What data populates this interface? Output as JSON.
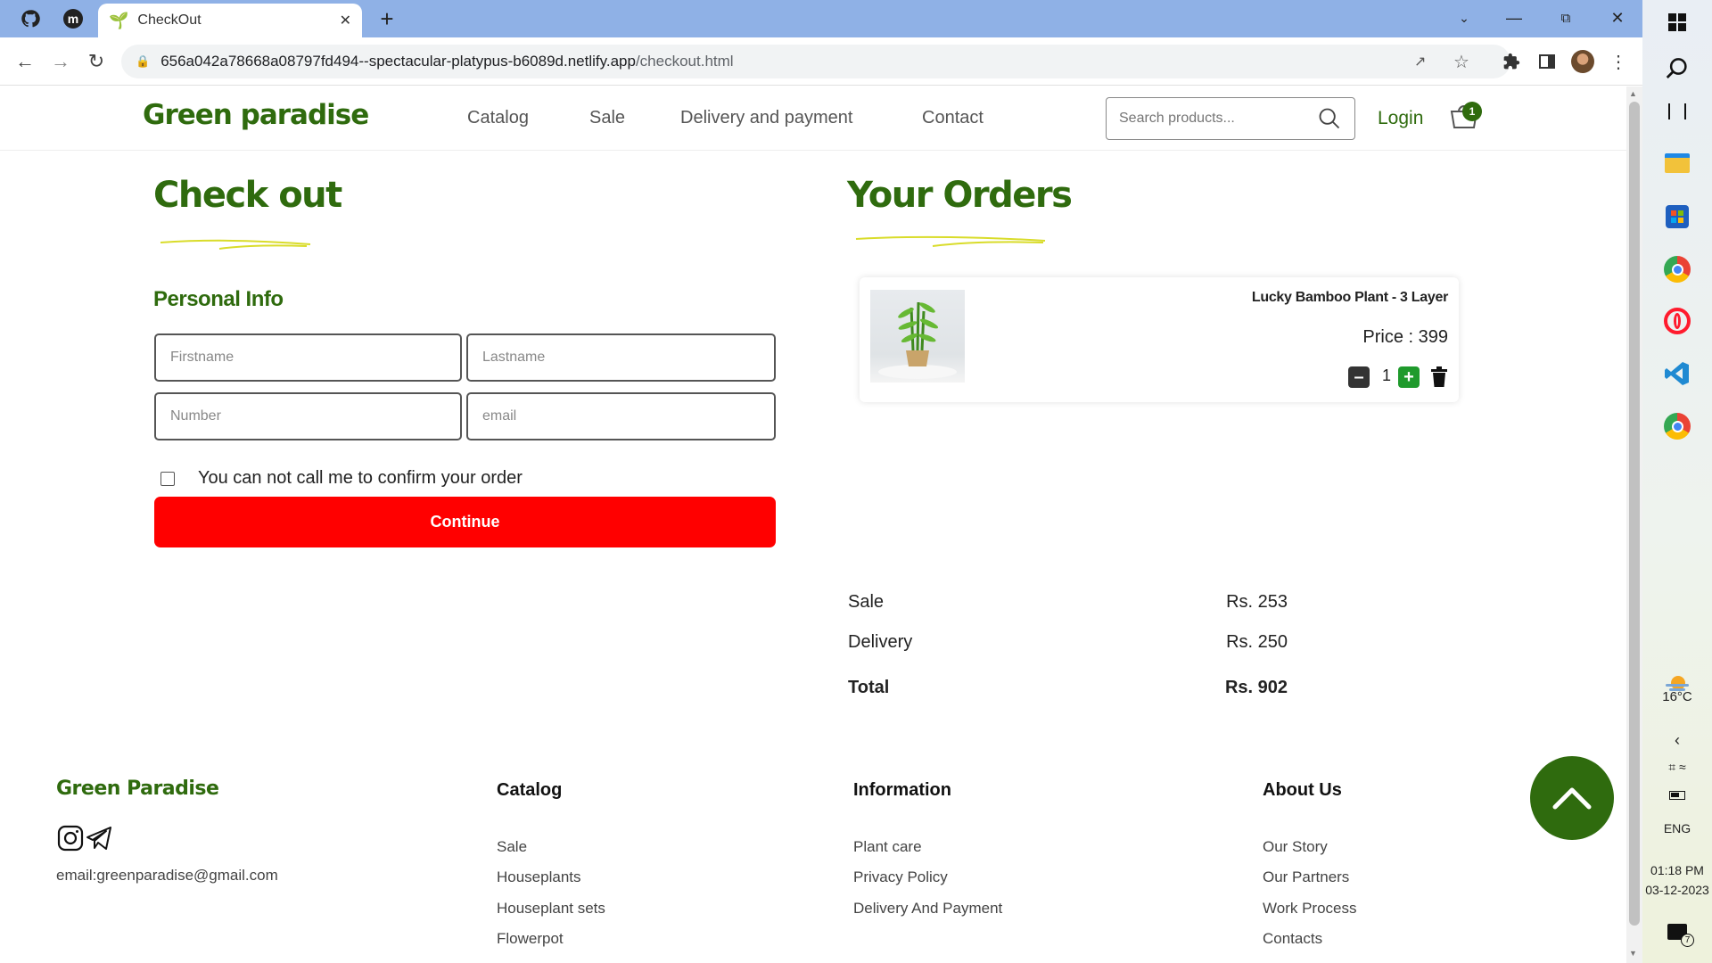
{
  "browser": {
    "tab_title": "CheckOut",
    "url_host": "656a042a78668a08797fd494--spectacular-platypus-b6089d.netlify.app",
    "url_path": "/checkout.html",
    "pinned_tabs": [
      "github-icon",
      "m-icon"
    ]
  },
  "site": {
    "logo": "Green paradise",
    "nav": [
      "Catalog",
      "Sale",
      "Delivery and payment",
      "Contact"
    ],
    "search_placeholder": "Search products...",
    "login": "Login",
    "cart_count": "1"
  },
  "checkout": {
    "title": "Check out",
    "section": "Personal Info",
    "fields": {
      "firstname": "Firstname",
      "lastname": "Lastname",
      "number": "Number",
      "email": "email"
    },
    "checkbox_label": "You can not call me to confirm your order",
    "continue": "Continue"
  },
  "orders": {
    "title": "Your Orders",
    "items": [
      {
        "name": "Lucky Bamboo Plant - 3 Layer",
        "price": "Price : 399",
        "qty": "1"
      }
    ],
    "summary": [
      {
        "label": "Sale",
        "value": "Rs. 253"
      },
      {
        "label": "Delivery",
        "value": "Rs. 250"
      },
      {
        "label": "Total",
        "value": "Rs. 902"
      }
    ]
  },
  "footer": {
    "brand": "Green Paradise",
    "email": "email:greenparadise@gmail.com",
    "columns": [
      {
        "title": "Catalog",
        "links": [
          "Sale",
          "Houseplants",
          "Houseplant sets",
          "Flowerpot"
        ]
      },
      {
        "title": "Information",
        "links": [
          "Plant care",
          "Privacy Policy",
          "Delivery And Payment"
        ]
      },
      {
        "title": "About Us",
        "links": [
          "Our Story",
          "Our Partners",
          "Work Process",
          "Contacts"
        ]
      }
    ]
  },
  "taskbar": {
    "temperature": "16°C",
    "language": "ENG",
    "time": "01:18 PM",
    "date": "03-12-2023",
    "notification_count": "7"
  },
  "colors": {
    "brand_green": "#2f6b0e",
    "continue_red": "#ff0000",
    "tab_strip": "#8fb1e6"
  }
}
